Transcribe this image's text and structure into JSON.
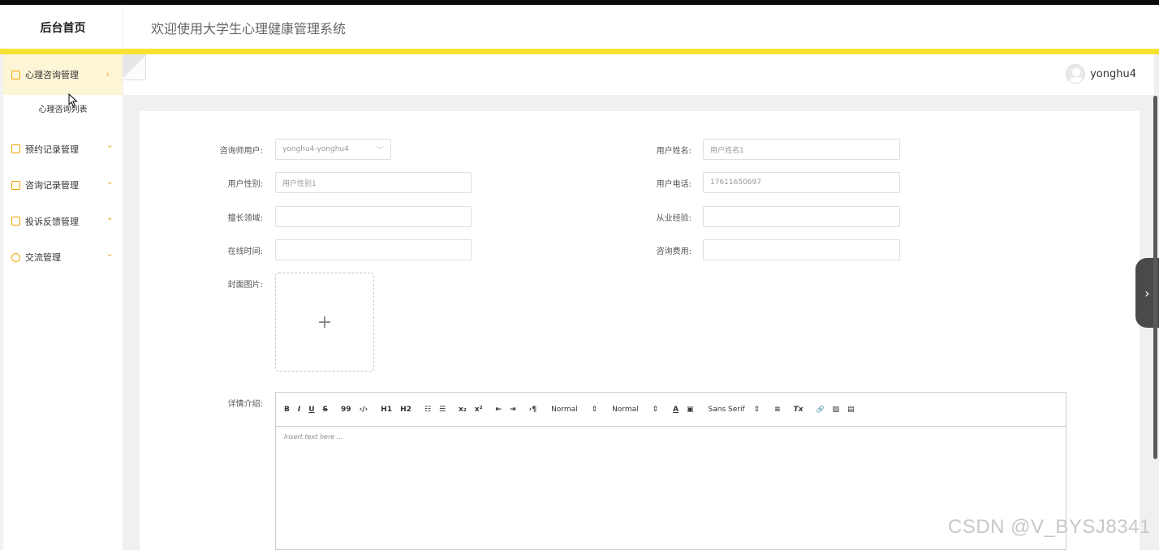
{
  "header": {
    "brand": "后台首页",
    "welcome": "欢迎使用大学生心理健康管理系统"
  },
  "sidebar": {
    "groups": [
      {
        "label": "心理咨询管理",
        "icon": "page-icon",
        "caret": "⌞",
        "active": true,
        "children": [
          "心理咨询列表"
        ]
      },
      {
        "label": "预约记录管理",
        "icon": "page-icon",
        "caret": "⌄"
      },
      {
        "label": "咨询记录管理",
        "icon": "page-icon",
        "caret": "⌄"
      },
      {
        "label": "投诉反馈管理",
        "icon": "page-icon",
        "caret": "⌄"
      },
      {
        "label": "交流管理",
        "icon": "chat-icon",
        "caret": "⌄"
      }
    ]
  },
  "topbar": {
    "username": "yonghu4"
  },
  "form": {
    "consultant_user": {
      "label": "咨询师用户:",
      "value": "yonghu4-yonghu4"
    },
    "user_name": {
      "label": "用户姓名:",
      "placeholder": "用户姓名1"
    },
    "user_gender": {
      "label": "用户性别:",
      "placeholder": "用户性别1"
    },
    "user_phone": {
      "label": "用户电话:",
      "value": "17611650697"
    },
    "specialty": {
      "label": "擅长领域:",
      "value": ""
    },
    "experience": {
      "label": "从业经验:",
      "value": ""
    },
    "online_time": {
      "label": "在线时间:",
      "value": ""
    },
    "fee": {
      "label": "咨询费用:",
      "value": ""
    },
    "cover": {
      "label": "封面图片:",
      "plus": "+"
    },
    "details": {
      "label": "详情介绍:",
      "placeholder": "Insert text here ..."
    }
  },
  "editor_toolbar": {
    "bold": "B",
    "italic": "I",
    "underline": "U",
    "strike": "S",
    "quote": "99",
    "code": "‹/›",
    "h1": "H1",
    "h2": "H2",
    "ol": "☷",
    "ul": "☰",
    "sub": "x₂",
    "sup": "x²",
    "outdent": "⇤",
    "indent": "⇥",
    "direction": "›¶",
    "size": "Normal",
    "header": "Normal",
    "color": "A",
    "background": "▣",
    "font": "Sans Serif",
    "align": "≡",
    "clean": "Tx",
    "link": "🔗",
    "image": "▨",
    "video": "▤"
  },
  "watermark": "CSDN @V_BYSJ8341",
  "colors": {
    "accent": "#f7e233",
    "active_bg": "#fdf6d6",
    "icon": "#f0a500"
  }
}
